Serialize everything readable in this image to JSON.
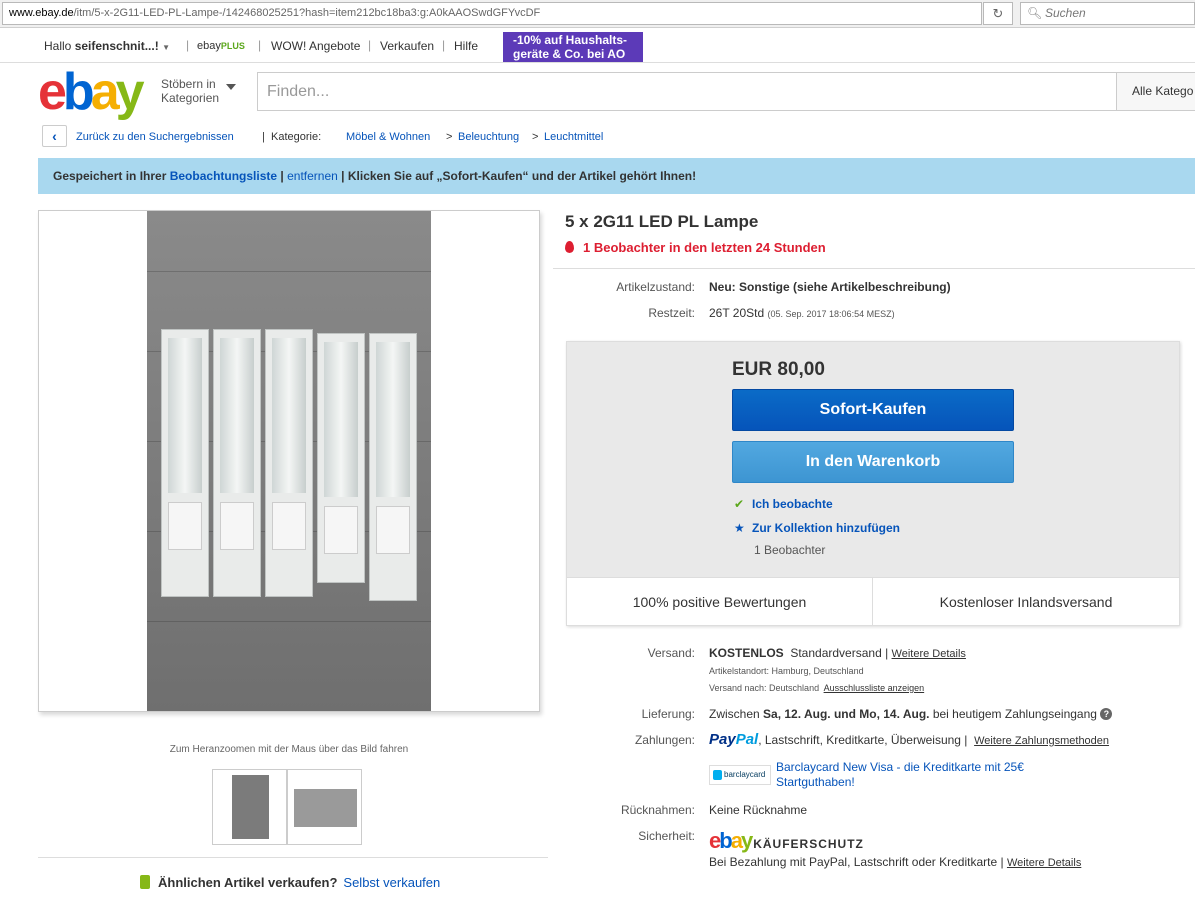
{
  "browser": {
    "url_domain": "www.ebay.de",
    "url_path": "/itm/5-x-2G11-LED-PL-Lampe-/142468025251?hash=item212bc18ba3:g:A0kAAOSwdGFYvcDF",
    "search_placeholder": "Suchen"
  },
  "topnav": {
    "greeting_prefix": "Hallo ",
    "username": "seifenschnit...!",
    "ebay_plus": "ebay",
    "plus": "PLUS",
    "items": [
      "WOW! Angebote",
      "Verkaufen",
      "Hilfe"
    ],
    "promo_line1": "-10% auf Haushalts-",
    "promo_line2": "geräte & Co. bei AO"
  },
  "header": {
    "browse_line1": "Stöbern in",
    "browse_line2": "Kategorien",
    "search_placeholder": "Finden...",
    "category_select": "Alle Katego"
  },
  "breadcrumb": {
    "back": "Zurück zu den Suchergebnissen",
    "category_label": "Kategorie:",
    "path": [
      "Möbel & Wohnen",
      "Beleuchtung",
      "Leuchtmittel"
    ]
  },
  "banner": {
    "prefix": "Gespeichert in Ihrer ",
    "watchlist": "Beobachtungsliste",
    "sep1": " | ",
    "remove": "entfernen",
    "suffix": " | Klicken Sie auf „Sofort-Kaufen“ und der Artikel gehört Ihnen!"
  },
  "gallery": {
    "zoom_hint": "Zum Heranzoomen mit der Maus über das Bild fahren"
  },
  "sell_similar": {
    "question": "Ähnlichen Artikel verkaufen?",
    "link": "Selbst verkaufen"
  },
  "item": {
    "title": "5 x 2G11 LED PL Lampe",
    "watchers_hot": "1 Beobachter in den letzten 24 Stunden",
    "condition_label": "Artikelzustand:",
    "condition_value": "Neu: Sonstige (siehe Artikelbeschreibung)",
    "time_label": "Restzeit:",
    "time_value": "26T 20Std",
    "time_end": "(05. Sep. 2017    18:06:54 MESZ)"
  },
  "buybox": {
    "price": "EUR 80,00",
    "buy_now": "Sofort-Kaufen",
    "add_to_cart": "In den Warenkorb",
    "watching": "Ich beobachte",
    "add_collection": "Zur Kollektion hinzufügen",
    "watch_count": "1 Beobachter",
    "positive": "100% positive Bewertungen",
    "free_shipping": "Kostenloser Inlandsversand"
  },
  "shipping": {
    "label": "Versand:",
    "free": "KOSTENLOS",
    "standard": "Standardversand |",
    "details_link": "Weitere Details",
    "location": "Artikelstandort:  Hamburg, Deutschland",
    "ships_to": "Versand nach:  Deutschland",
    "exclusion_link": "Ausschlussliste anzeigen"
  },
  "delivery": {
    "label": "Lieferung:",
    "pre": "Zwischen ",
    "dates": "Sa, 12. Aug. und Mo, 14. Aug.",
    "post": " bei heutigem Zahlungseingang",
    "help": "?"
  },
  "payments": {
    "label": "Zahlungen:",
    "paypal_a": "Pay",
    "paypal_b": "Pal",
    "methods": ",  Lastschrift,  Kreditkarte,  Überweisung  |",
    "more_link": "Weitere Zahlungsmethoden",
    "barclay_logo": "barclaycard",
    "barclay_line1": "Barclaycard New Visa - die Kreditkarte mit 25€",
    "barclay_line2": "Startguthaben!"
  },
  "returns": {
    "label": "Rücknahmen:",
    "value": "Keine Rücknahme"
  },
  "security": {
    "label": "Sicherheit:",
    "logo": "ebay",
    "protection": "KÄUFERSCHUTZ",
    "text": "Bei Bezahlung mit PayPal, Lastschrift oder Kreditkarte |",
    "details_link": "Weitere Details"
  },
  "colors": {
    "ebay_red": "#e53238",
    "ebay_blue": "#0064d2",
    "ebay_yellow": "#f5af02",
    "ebay_green": "#86b817",
    "link_blue": "#0654ba",
    "banner_blue": "#a9d8ef",
    "promo_purple": "#5c3ab8"
  }
}
